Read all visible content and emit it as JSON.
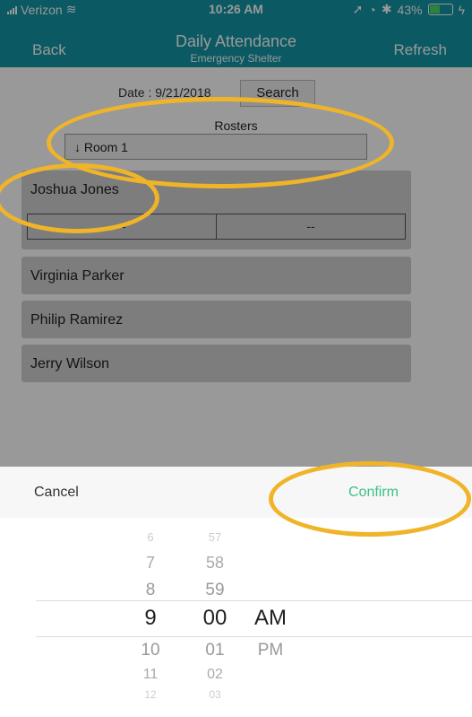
{
  "status": {
    "carrier": "Verizon",
    "time": "10:26 AM",
    "battery": "43%"
  },
  "nav": {
    "back": "Back",
    "title": "Daily Attendance",
    "subtitle": "Emergency Shelter",
    "refresh": "Refresh"
  },
  "filters": {
    "date_label": "Date : 9/21/2018",
    "search": "Search",
    "rosters_label": "Rosters",
    "roster_value": "↓ Room 1"
  },
  "people": [
    {
      "name": "Joshua Jones",
      "in": "--",
      "out": "--"
    },
    {
      "name": "Virginia Parker"
    },
    {
      "name": "Philip Ramirez"
    },
    {
      "name": "Jerry Wilson"
    }
  ],
  "sheet": {
    "cancel": "Cancel",
    "confirm": "Confirm"
  },
  "picker": {
    "hours": [
      "6",
      "7",
      "8",
      "9",
      "10",
      "11",
      "12"
    ],
    "minutes": [
      "57",
      "58",
      "59",
      "00",
      "01",
      "02",
      "03"
    ],
    "ampm": [
      "AM",
      "PM"
    ],
    "selected": {
      "hour": "9",
      "minute": "00",
      "ampm": "AM"
    }
  },
  "colors": {
    "header": "#1295a6",
    "confirm": "#3cc188",
    "highlight": "#f0b429"
  }
}
